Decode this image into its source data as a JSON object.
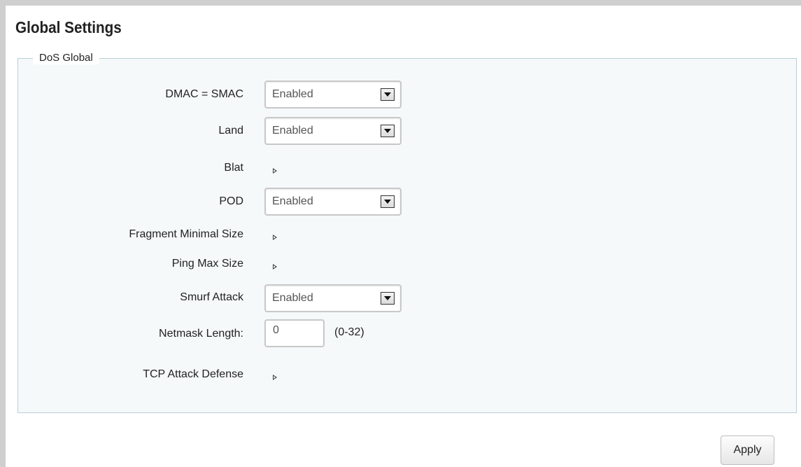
{
  "page": {
    "title": "Global Settings"
  },
  "dos_global": {
    "legend": "DoS Global",
    "rows": {
      "dmac_smac": {
        "label": "DMAC = SMAC",
        "value": "Enabled"
      },
      "land": {
        "label": "Land",
        "value": "Enabled"
      },
      "blat": {
        "label": "Blat"
      },
      "pod": {
        "label": "POD",
        "value": "Enabled"
      },
      "fragment_minimal_size": {
        "label": "Fragment Minimal Size"
      },
      "ping_max_size": {
        "label": "Ping Max Size"
      },
      "smurf_attack": {
        "label": "Smurf Attack",
        "value": "Enabled"
      },
      "netmask_length": {
        "label": "Netmask Length:",
        "value": "0",
        "range": "(0-32)"
      },
      "tcp_attack_defense": {
        "label": "TCP Attack Defense"
      }
    }
  },
  "actions": {
    "apply_label": "Apply"
  },
  "icons": {
    "dropdown": "chevron-down-icon",
    "expander": "triangle-right-icon"
  }
}
